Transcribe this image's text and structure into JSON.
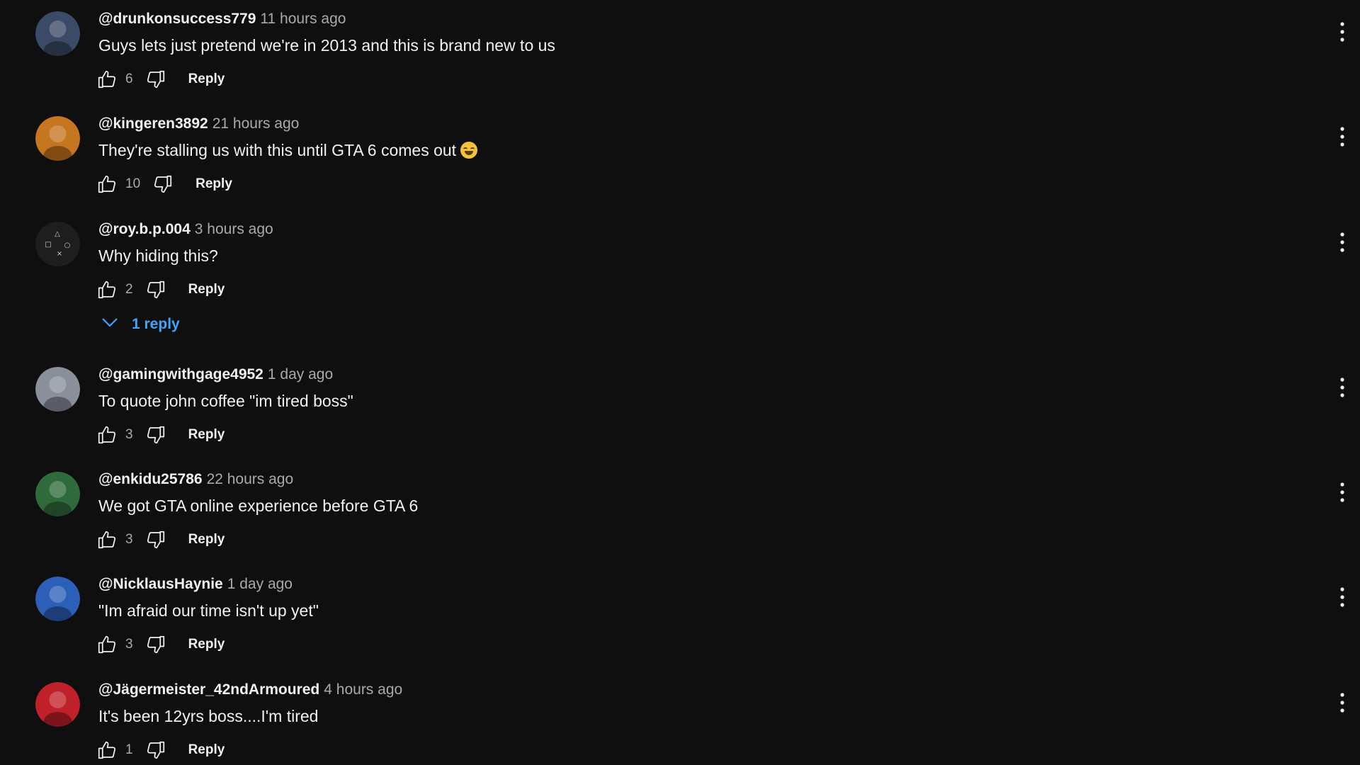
{
  "comments": [
    {
      "author": "@drunkonsuccess779",
      "time": "11 hours ago",
      "text": "Guys lets just pretend we're in 2013 and this is brand new to us",
      "likes": "6",
      "reply_label": "Reply",
      "avatar_color": "#3b4a66"
    },
    {
      "author": "@kingeren3892",
      "time": "21 hours ago",
      "text": "They're stalling us with this until GTA 6 comes out",
      "likes": "10",
      "reply_label": "Reply",
      "avatar_color": "#c5761f"
    },
    {
      "author": "@roy.b.p.004",
      "time": "3 hours ago",
      "text": "Why hiding this?",
      "likes": "2",
      "reply_label": "Reply",
      "avatar_color": "#1e1e1e"
    },
    {
      "author": "@gamingwithgage4952",
      "time": "1 day ago",
      "text": "To quote john coffee \"im tired boss\"",
      "likes": "3",
      "reply_label": "Reply",
      "avatar_color": "#8a8f9c"
    },
    {
      "author": "@enkidu25786",
      "time": "22 hours ago",
      "text": "We got GTA online experience before GTA 6",
      "likes": "3",
      "reply_label": "Reply",
      "avatar_color": "#2f6b3a"
    },
    {
      "author": "@NicklausHaynie",
      "time": "1 day ago",
      "text": "\"Im afraid our time isn't up yet\"",
      "likes": "3",
      "reply_label": "Reply",
      "avatar_color": "#2b5fb8"
    },
    {
      "author": "@Jägermeister_42ndArmoured",
      "time": "4 hours ago",
      "text": "It's been 12yrs boss....I'm tired",
      "likes": "1",
      "reply_label": "Reply",
      "avatar_color": "#c0202a"
    }
  ],
  "replies_toggle": {
    "label": "1 reply",
    "color": "#3ea6ff"
  },
  "icons": {
    "like": "thumbs-up-icon",
    "dislike": "thumbs-down-icon",
    "more": "more-vertical-icon",
    "chevron": "chevron-down-icon"
  },
  "colors": {
    "background": "#0f0f0f",
    "text": "#f1f1f1",
    "secondary": "#aaaaaa",
    "link": "#3ea6ff"
  }
}
